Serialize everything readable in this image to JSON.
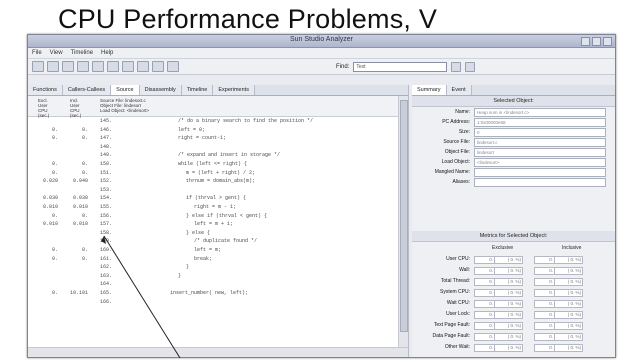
{
  "slide": {
    "title": "CPU Performance Problems, V"
  },
  "window": {
    "title": "Sun Studio Analyzer"
  },
  "menu": [
    "File",
    "View",
    "Timeline",
    "Help"
  ],
  "find": {
    "label": "Find:",
    "value": "Text"
  },
  "left_tabs": [
    "Functions",
    "Callers-Callees",
    "Source",
    "Disassembly",
    "Timeline",
    "Experiments"
  ],
  "right_tabs": [
    "Summary",
    "Event"
  ],
  "columns": {
    "c1": [
      "Excl.",
      "User",
      "CPU",
      "(sec.)"
    ],
    "c2": [
      "Incl.",
      "User",
      "CPU",
      "(sec.)"
    ],
    "c3": [
      "Source File: lindesort.c",
      "Object File: lindesort",
      "Load Object: <lindesort>"
    ]
  },
  "rows": [
    {
      "c1": "",
      "c2": "",
      "ln": "145.",
      "src": "/* do a binary search to find the position */"
    },
    {
      "c1": "0.",
      "c2": "0.",
      "ln": "146.",
      "src": "left = 0;"
    },
    {
      "c1": "0.",
      "c2": "0.",
      "ln": "147.",
      "src": "right = count-1;"
    },
    {
      "c1": "",
      "c2": "",
      "ln": "148.",
      "src": ""
    },
    {
      "c1": "",
      "c2": "",
      "ln": "149.",
      "src": "/* expand and insert in storage */"
    },
    {
      "c1": "0.",
      "c2": "0.",
      "ln": "150.",
      "src": "while (left <= right) {"
    },
    {
      "c1": "0.",
      "c2": "0.",
      "ln": "151.",
      "src": "m = (left + right) / 2;"
    },
    {
      "c1": "0.020",
      "c2": "0.040",
      "ln": "152.",
      "src": "thrnum = domain_abs(m);"
    },
    {
      "c1": "",
      "c2": "",
      "ln": "153.",
      "src": ""
    },
    {
      "c1": "0.030",
      "c2": "0.030",
      "ln": "154.",
      "src": "if (thrval > gent) {"
    },
    {
      "c1": "0.010",
      "c2": "0.010",
      "ln": "155.",
      "src": "right = m - 1;"
    },
    {
      "c1": "0.",
      "c2": "0.",
      "ln": "156.",
      "src": "} else if (thrval < gent) {"
    },
    {
      "c1": "0.010",
      "c2": "0.010",
      "ln": "157.",
      "src": "left = m + 1;"
    },
    {
      "c1": "",
      "c2": "",
      "ln": "158.",
      "src": "} else {"
    },
    {
      "c1": "",
      "c2": "",
      "ln": "159.",
      "src": "/* duplicate found */"
    },
    {
      "c1": "0.",
      "c2": "0.",
      "ln": "160.",
      "src": "left = m;"
    },
    {
      "c1": "0.",
      "c2": "0.",
      "ln": "161.",
      "src": "break;"
    },
    {
      "c1": "",
      "c2": "",
      "ln": "162.",
      "src": "}"
    },
    {
      "c1": "",
      "c2": "",
      "ln": "163.",
      "src": "}"
    },
    {
      "c1": "",
      "c2": "",
      "ln": "164.",
      "src": ""
    },
    {
      "c1": "0.",
      "c2": "10.101",
      "ln": "165.",
      "src": "insert_number( new, left);"
    },
    {
      "c1": "",
      "c2": "",
      "ln": "166.",
      "src": ""
    }
  ],
  "selected": {
    "header": "Selected Object:",
    "fields": [
      {
        "label": "Name:",
        "value": "Heap sum in <lindesort.c>"
      },
      {
        "label": "PC Address:",
        "value": "1:0x00000e58"
      },
      {
        "label": "Size:",
        "value": "0"
      },
      {
        "label": "Source File:",
        "value": "lindesort.c"
      },
      {
        "label": "Object File:",
        "value": "lindesort"
      },
      {
        "label": "Load Object:",
        "value": "<lindesort>"
      },
      {
        "label": "Mangled Name:",
        "value": ""
      },
      {
        "label": "Aliases:",
        "value": ""
      }
    ]
  },
  "metrics": {
    "header": "Metrics for Selected Object:",
    "exclusive": "Exclusive",
    "inclusive": "Inclusive",
    "rows": [
      {
        "label": "User CPU:",
        "cells": [
          "0.",
          "( 0. %)",
          "0.",
          "( 0. %)"
        ]
      },
      {
        "label": "Wall:",
        "cells": [
          "0.",
          "( 0. %)",
          "0.",
          "( 0. %)"
        ]
      },
      {
        "label": "Total Thread:",
        "cells": [
          "0.",
          "( 0. %)",
          "0.",
          "( 0. %)"
        ]
      },
      {
        "label": "System CPU:",
        "cells": [
          "0.",
          "( 0. %)",
          "0.",
          "( 0. %)"
        ]
      },
      {
        "label": "Wait CPU:",
        "cells": [
          "0.",
          "( 0. %)",
          "0.",
          "( 0. %)"
        ]
      },
      {
        "label": "User Lock:",
        "cells": [
          "0.",
          "( 0. %)",
          "0.",
          "( 0. %)"
        ]
      },
      {
        "label": "Text Page Fault:",
        "cells": [
          "0.",
          "( 0. %)",
          "0.",
          "( 0. %)"
        ]
      },
      {
        "label": "Data Page Fault:",
        "cells": [
          "0.",
          "( 0. %)",
          "0.",
          "( 0. %)"
        ]
      },
      {
        "label": "Other Wait:",
        "cells": [
          "0.",
          "( 0. %)",
          "0.",
          "( 0. %)"
        ]
      }
    ]
  }
}
